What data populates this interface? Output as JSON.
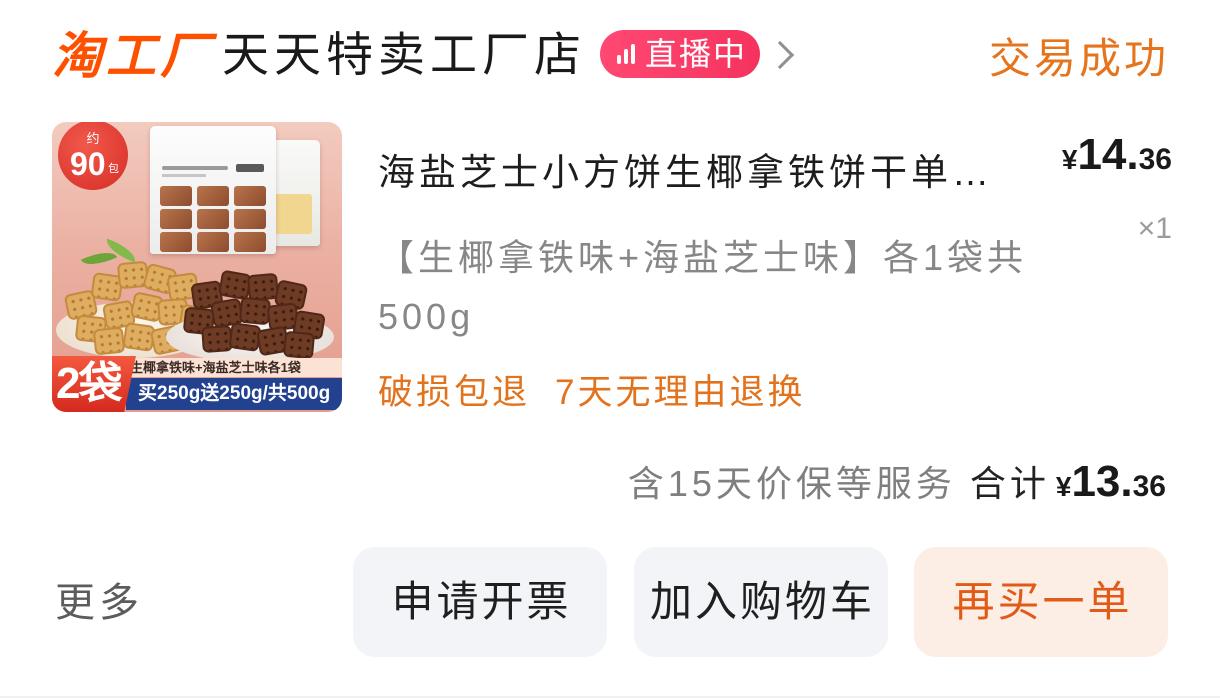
{
  "shop": {
    "logo_text": "淘工厂",
    "name": "天天特卖工厂店",
    "live_badge": "直播中",
    "status": "交易成功"
  },
  "item": {
    "title": "海盐芝士小方饼生椰拿铁饼干单…",
    "sku": "【生椰拿铁味+海盐芝士味】各1袋共500g",
    "price": {
      "currency": "¥",
      "amount": "14.36"
    },
    "quantity": "×1",
    "tags": [
      "破损包退",
      "7天无理由退换"
    ],
    "image": {
      "badge_prefix": "约",
      "badge_number": "90",
      "badge_unit": "包",
      "count_label": "2袋",
      "flavor_label": "生椰拿铁味+海盐芝士味各1袋",
      "promo_label": "买250g送250g/共500g"
    }
  },
  "summary": {
    "service_note": "含15天价保等服务",
    "total_label": "合计",
    "total": {
      "currency": "¥",
      "amount": "13.36"
    }
  },
  "actions": {
    "more_label": "更多",
    "buttons": [
      {
        "label": "申请开票"
      },
      {
        "label": "加入购物车"
      },
      {
        "label": "再买一单"
      }
    ]
  },
  "icons": {
    "live": "live-bars-icon",
    "shop_link": "chevron-right-icon"
  },
  "colors": {
    "logo": "#ff5000",
    "status": "#e6741d",
    "tag": "#e3721d",
    "live": "#f5335e",
    "btn_primary_bg": "#fdeee5",
    "btn_primary_text": "#e25a17",
    "btn_secondary_bg": "#f2f4f8"
  }
}
